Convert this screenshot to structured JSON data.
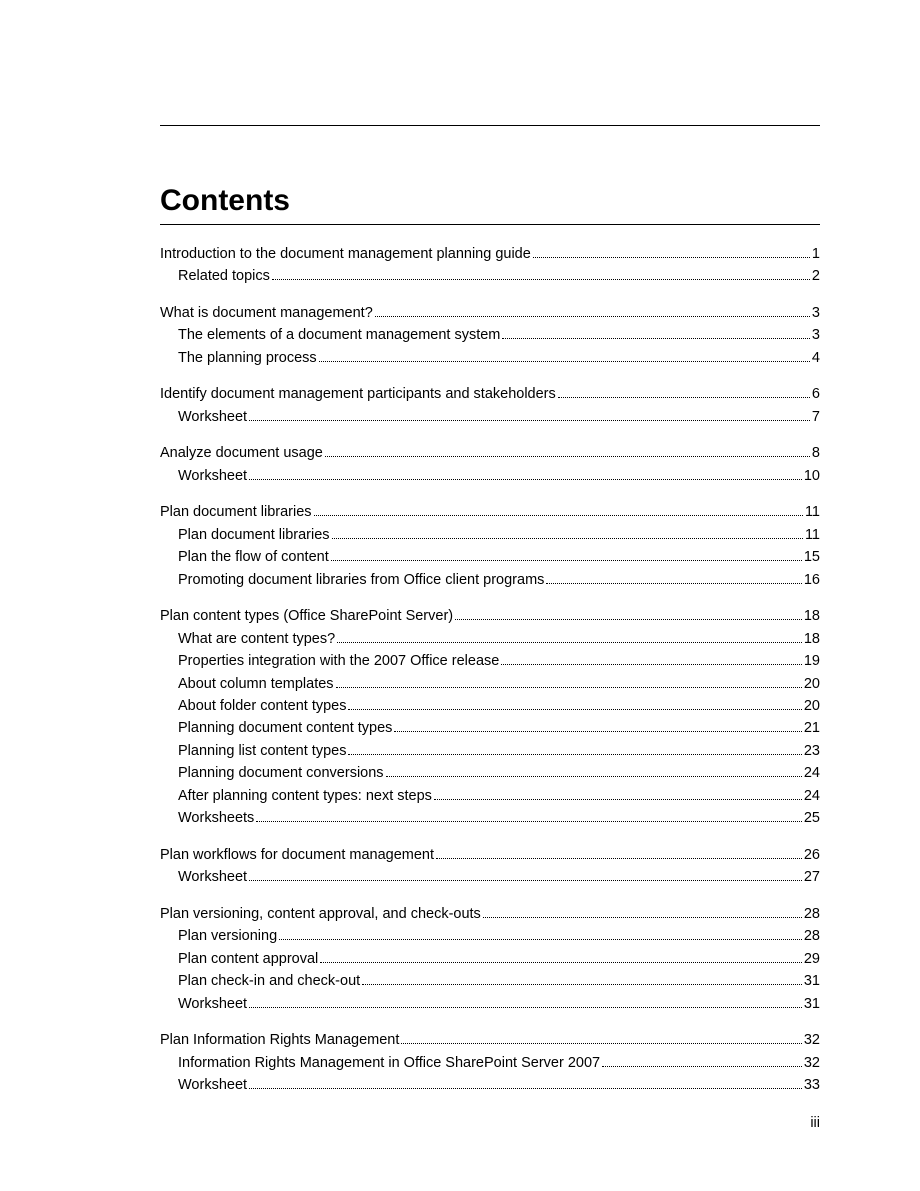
{
  "heading": "Contents",
  "page_number": "iii",
  "sections": [
    {
      "entries": [
        {
          "title": "Introduction to the document management planning guide",
          "page": "1",
          "level": 0
        },
        {
          "title": "Related topics",
          "page": "2",
          "level": 1
        }
      ]
    },
    {
      "entries": [
        {
          "title": "What is document management?",
          "page": "3",
          "level": 0
        },
        {
          "title": "The elements of a document management system",
          "page": "3",
          "level": 1
        },
        {
          "title": "The planning process",
          "page": "4",
          "level": 1
        }
      ]
    },
    {
      "entries": [
        {
          "title": "Identify document management participants and stakeholders",
          "page": "6",
          "level": 0
        },
        {
          "title": "Worksheet",
          "page": "7",
          "level": 1
        }
      ]
    },
    {
      "entries": [
        {
          "title": "Analyze document usage",
          "page": "8",
          "level": 0
        },
        {
          "title": "Worksheet",
          "page": "10",
          "level": 1
        }
      ]
    },
    {
      "entries": [
        {
          "title": "Plan document libraries",
          "page": "11",
          "level": 0
        },
        {
          "title": "Plan document libraries",
          "page": "11",
          "level": 1
        },
        {
          "title": "Plan the flow of content",
          "page": "15",
          "level": 1
        },
        {
          "title": "Promoting document libraries from Office client programs",
          "page": "16",
          "level": 1
        }
      ]
    },
    {
      "entries": [
        {
          "title": "Plan content types (Office SharePoint Server)",
          "page": "18",
          "level": 0
        },
        {
          "title": "What are content types?",
          "page": "18",
          "level": 1
        },
        {
          "title": "Properties integration with the 2007 Office release",
          "page": "19",
          "level": 1
        },
        {
          "title": "About column templates",
          "page": "20",
          "level": 1
        },
        {
          "title": "About folder content types",
          "page": "20",
          "level": 1
        },
        {
          "title": "Planning document content types",
          "page": "21",
          "level": 1
        },
        {
          "title": "Planning list content types",
          "page": "23",
          "level": 1
        },
        {
          "title": "Planning document conversions",
          "page": "24",
          "level": 1
        },
        {
          "title": "After planning content types: next steps",
          "page": "24",
          "level": 1
        },
        {
          "title": "Worksheets",
          "page": "25",
          "level": 1
        }
      ]
    },
    {
      "entries": [
        {
          "title": "Plan workflows for document management",
          "page": "26",
          "level": 0
        },
        {
          "title": "Worksheet",
          "page": "27",
          "level": 1
        }
      ]
    },
    {
      "entries": [
        {
          "title": "Plan versioning, content approval, and check-outs",
          "page": "28",
          "level": 0
        },
        {
          "title": "Plan versioning",
          "page": "28",
          "level": 1
        },
        {
          "title": "Plan content approval",
          "page": "29",
          "level": 1
        },
        {
          "title": "Plan check-in and check-out",
          "page": "31",
          "level": 1
        },
        {
          "title": "Worksheet",
          "page": "31",
          "level": 1
        }
      ]
    },
    {
      "entries": [
        {
          "title": "Plan Information Rights Management",
          "page": "32",
          "level": 0
        },
        {
          "title": "Information Rights Management in Office SharePoint Server 2007",
          "page": "32",
          "level": 1
        },
        {
          "title": "Worksheet",
          "page": "33",
          "level": 1
        }
      ]
    }
  ]
}
